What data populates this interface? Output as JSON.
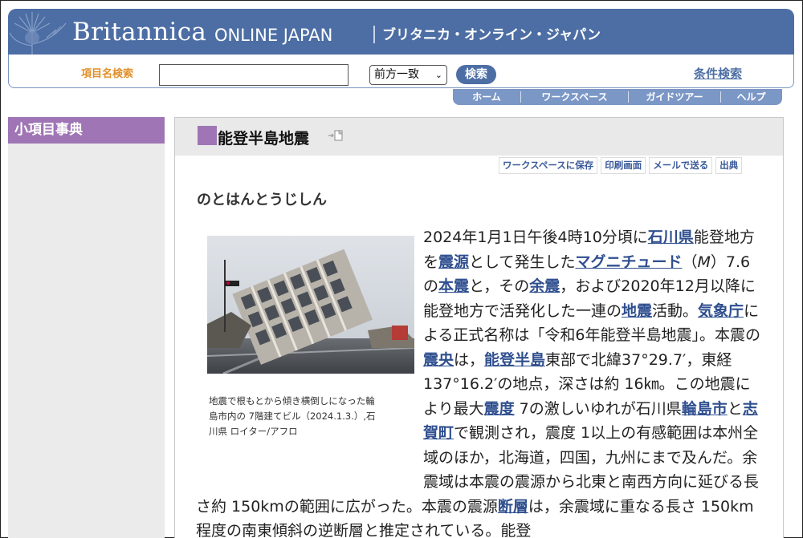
{
  "header": {
    "brand": "Britannica",
    "brand_sub": "ONLINE JAPAN",
    "brand_ja": "ブリタニカ・オンライン・ジャパン"
  },
  "search": {
    "label": "項目名検索",
    "input_value": "",
    "mode": "前方一致",
    "submit_label": "検索",
    "advanced_label": "条件検索"
  },
  "topnav": [
    "ホーム",
    "ワークスペース",
    "ガイドツアー",
    "ヘルプ"
  ],
  "sidebar": {
    "title": "小項目事典"
  },
  "article": {
    "title": "能登半島地震",
    "reading": "のとはんとうじしん",
    "toolbar": [
      "ワークスペースに保存",
      "印刷画面",
      "メールで送る",
      "出典"
    ],
    "caption": "地震で根もとから傾き横倒しになった輪島市内の 7階建てビル（2024.1.3.）,石川県 ロイター/アフロ",
    "body": [
      {
        "t": "2024年1月1日午後4時10分頃に"
      },
      {
        "t": "石川県",
        "link": true
      },
      {
        "t": "能登地方を"
      },
      {
        "t": "震源",
        "link": true
      },
      {
        "t": "として発生した"
      },
      {
        "t": "マグニチュード",
        "link": true
      },
      {
        "t": "（"
      },
      {
        "t": "M",
        "italic": true
      },
      {
        "t": "）7.6の"
      },
      {
        "t": "本震",
        "link": true
      },
      {
        "t": "と，その"
      },
      {
        "t": "余震",
        "link": true
      },
      {
        "t": "，および2020年12月以降に能登地方で活発化した一連の"
      },
      {
        "t": "地震",
        "link": true
      },
      {
        "t": "活動。"
      },
      {
        "t": "気象庁",
        "link": true
      },
      {
        "t": "による正式名称は「令和6年能登半島地震」。本震の"
      },
      {
        "t": "震央",
        "link": true
      },
      {
        "t": "は，"
      },
      {
        "t": "能登半島",
        "link": true
      },
      {
        "t": "東部で北緯37°29.7′，東経137°16.2′の地点，深さは約 16㎞。この地震により最大"
      },
      {
        "t": "震度",
        "link": true
      },
      {
        "t": " 7の激しいゆれが石川県"
      },
      {
        "t": "輪島市",
        "link": true
      },
      {
        "t": "と"
      },
      {
        "t": "志賀町",
        "link": true
      },
      {
        "t": "で観測され，震度 1以上の有感範囲は本州全域のほか，北海道，四国，九州にまで及んだ。余震域は本震の震源から北東と南西方向に延びる長さ約 150kmの範囲に広がった。本震の震源"
      },
      {
        "t": "断層",
        "link": true
      },
      {
        "t": "は，余震域に重なる長さ 150km程度の南東傾斜の逆断層と推定されている。能登"
      }
    ]
  },
  "colors": {
    "header_blue": "#4d6ea4",
    "nav_blue": "#7b97c6",
    "accent_purple": "#9f75b5",
    "search_label_orange": "#e0902c",
    "link_blue": "#2f4f8f"
  }
}
